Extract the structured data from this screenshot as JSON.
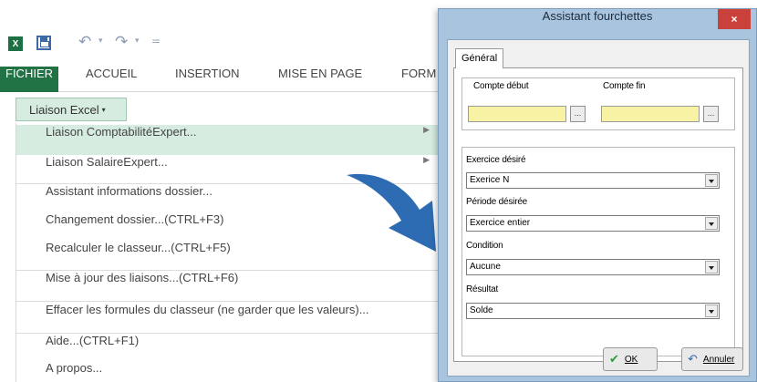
{
  "excel": {
    "app_icon": "excel-logo-icon",
    "app_icon_text": "X",
    "qat": {
      "save_icon": "save-icon",
      "undo_glyph": "↶",
      "redo_glyph": "↷",
      "caret": "▾",
      "customize_glyph": "="
    },
    "ribbon_tabs": [
      {
        "label": "FICHIER",
        "active": true
      },
      {
        "label": "ACCUEIL",
        "active": false
      },
      {
        "label": "INSERTION",
        "active": false
      },
      {
        "label": "MISE EN PAGE",
        "active": false
      },
      {
        "label": "FORM",
        "active": false
      }
    ],
    "liaison_button": {
      "label": "Liaison Excel",
      "caret": "▾"
    },
    "menu": {
      "submenu_arrow": "▶",
      "items": [
        {
          "label": "Liaison ComptabilitéExpert...",
          "submenu": true,
          "highlight": true
        },
        {
          "label": "Liaison SalaireExpert...",
          "submenu": true
        },
        {
          "label": "Assistant informations dossier..."
        },
        {
          "label": "Changement dossier...(CTRL+F3)"
        },
        {
          "label": "Recalculer le classeur...(CTRL+F5)"
        },
        {
          "label": "Mise à jour des liaisons...(CTRL+F6)"
        },
        {
          "label": "Effacer les formules du classeur (ne garder que les valeurs)..."
        },
        {
          "label": "Aide...(CTRL+F1)"
        },
        {
          "label": "A propos..."
        }
      ]
    }
  },
  "arrow": {
    "color": "#2d6bb2"
  },
  "dialog": {
    "title": "Assistant fourchettes",
    "close_glyph": "×",
    "tab": "Général",
    "compte_debut_label": "Compte début",
    "compte_fin_label": "Compte fin",
    "compte_debut_value": "",
    "compte_fin_value": "",
    "ellipsis": "...",
    "fields": [
      {
        "label": "Exercice désiré",
        "value": "Exerice N"
      },
      {
        "label": "Période désirée",
        "value": "Exercice entier"
      },
      {
        "label": "Condition",
        "value": "Aucune"
      },
      {
        "label": "Résultat",
        "value": "Solde"
      }
    ],
    "ok": {
      "label": "OK",
      "glyph": "✔"
    },
    "cancel": {
      "label": "Annuler",
      "glyph": "↶"
    }
  },
  "colors": {
    "excel_green": "#217346",
    "menu_highlight": "#d6ece0",
    "field_yellow": "#f7f2a4",
    "dialog_frame": "#a9c4de"
  }
}
